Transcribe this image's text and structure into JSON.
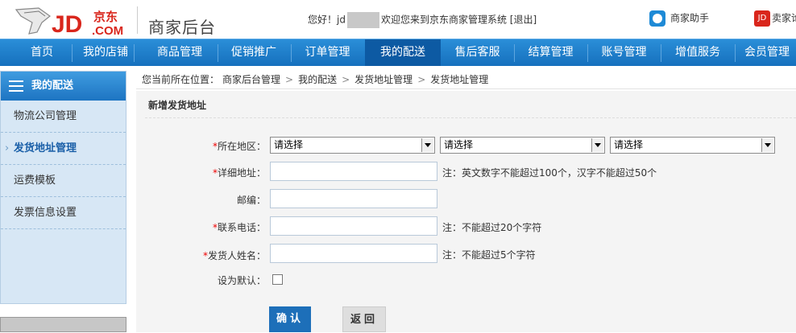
{
  "header": {
    "logo_text": "JD",
    "logo_cn": "京东",
    "logo_domain": ".COM",
    "subtitle": "商家后台",
    "greeting_prefix": "您好！jd",
    "greeting_suffix": "欢迎您来到京东商家管理系统",
    "logout": "[退出]",
    "helper": "商家助手",
    "seller_icon": "JD",
    "seller": "卖家论"
  },
  "nav": {
    "items": [
      "首页",
      "我的店铺",
      "商品管理",
      "促销推广",
      "订单管理",
      "我的配送",
      "售后客服",
      "结算管理",
      "账号管理",
      "增值服务",
      "会员管理"
    ],
    "active_index": 5
  },
  "sidebar": {
    "title": "我的配送",
    "items": [
      "物流公司管理",
      "发货地址管理",
      "运费模板",
      "发票信息设置"
    ],
    "active_index": 1
  },
  "breadcrumb": {
    "prefix": "您当前所在位置：",
    "items": [
      "商家后台管理",
      "我的配送",
      "发货地址管理",
      "发货地址管理"
    ],
    "separator": ">"
  },
  "form": {
    "title": "新增发货地址",
    "region_label": "所在地区：",
    "region_selects": [
      "请选择",
      "请选择",
      "请选择"
    ],
    "address_label": "详细地址：",
    "address_note": "注：英文数字不能超过100个，汉字不能超过50个",
    "zip_label": "邮编：",
    "phone_label": "联系电话：",
    "phone_note": "注：不能超过20个字符",
    "sender_label": "发货人姓名：",
    "sender_note": "注：不能超过5个字符",
    "default_label": "设为默认：",
    "required_mark": "*",
    "confirm": "确认",
    "back": "返回"
  },
  "colors": {
    "nav": "#1670bd",
    "nav_active": "#0d5aa3",
    "brand_red": "#d9261c",
    "required": "#e00000"
  }
}
